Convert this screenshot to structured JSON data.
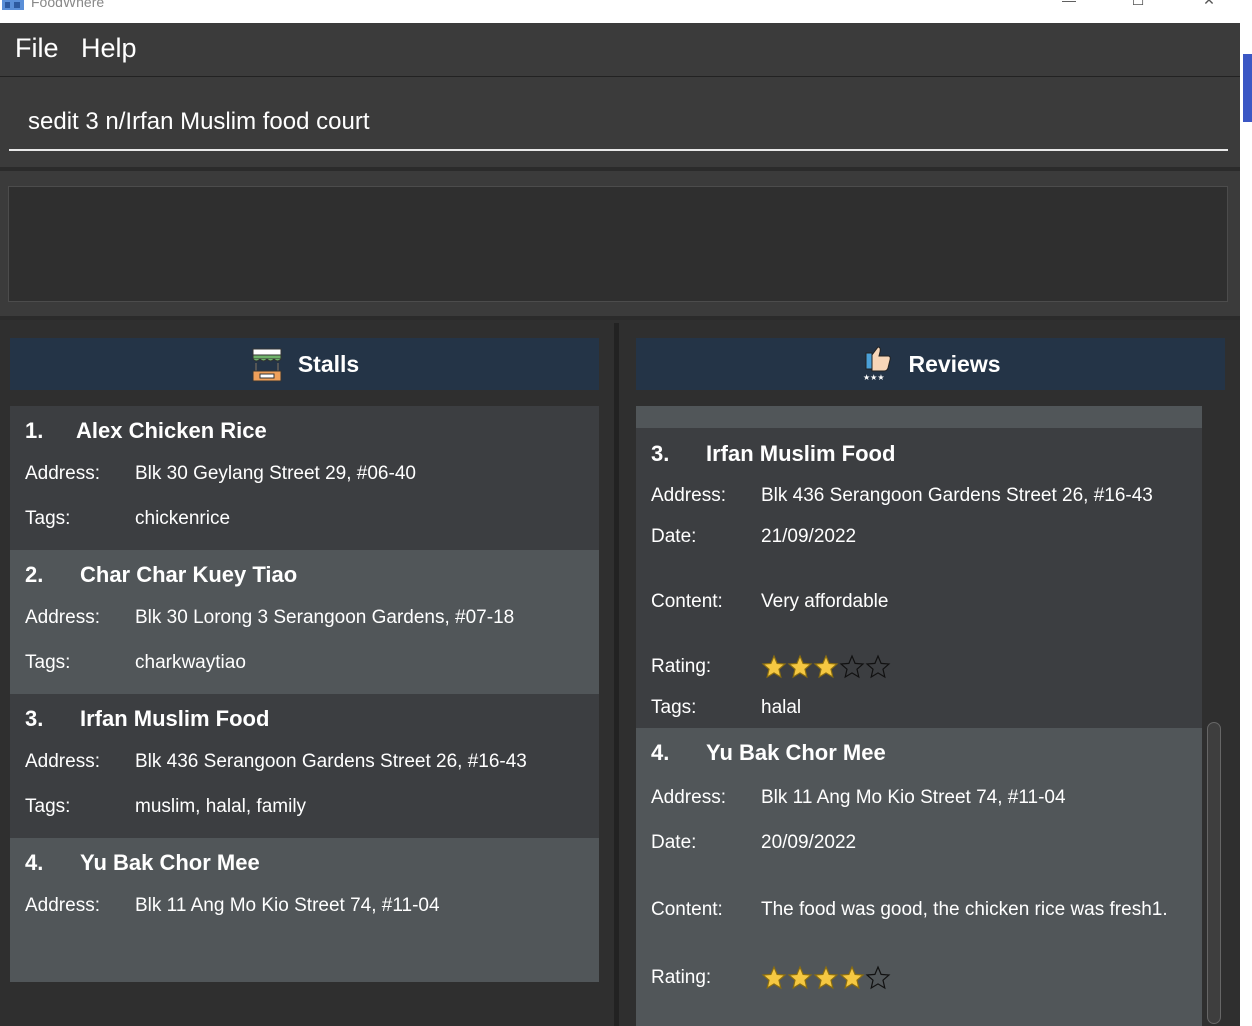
{
  "window": {
    "title": "FoodWhere",
    "minimize_icon": "minimize-icon",
    "maximize_icon": "maximize-icon",
    "close_icon": "close-icon"
  },
  "menu": {
    "file": "File",
    "help": "Help"
  },
  "command": {
    "value": "sedit 3 n/Irfan Muslim food court"
  },
  "result": {
    "text": ""
  },
  "stalls": {
    "header": "Stalls",
    "icon": "stall-icon",
    "items": [
      {
        "index": "1.",
        "name": "Alex Chicken Rice",
        "address_label": "Address:",
        "address": "Blk 30 Geylang Street 29, #06-40",
        "tags_label": "Tags:",
        "tags": "chickenrice"
      },
      {
        "index": "2.",
        "name": "Char Char Kuey Tiao",
        "address_label": "Address:",
        "address": "Blk 30 Lorong 3 Serangoon Gardens, #07-18",
        "tags_label": "Tags:",
        "tags": "charkwaytiao"
      },
      {
        "index": "3.",
        "name": "Irfan Muslim Food",
        "address_label": "Address:",
        "address": "Blk 436 Serangoon Gardens Street 26, #16-43",
        "tags_label": "Tags:",
        "tags": "muslim, halal, family"
      },
      {
        "index": "4.",
        "name": "Yu Bak Chor Mee",
        "address_label": "Address:",
        "address": "Blk 11 Ang Mo Kio Street 74, #11-04"
      }
    ]
  },
  "reviews": {
    "header": "Reviews",
    "icon": "thumbs-up-icon",
    "items": [
      {
        "index": "3.",
        "name": "Irfan Muslim Food",
        "address_label": "Address:",
        "address": "Blk 436 Serangoon Gardens Street 26, #16-43",
        "date_label": "Date:",
        "date": "21/09/2022",
        "content_label": "Content:",
        "content": "Very affordable",
        "rating_label": "Rating:",
        "rating": 3,
        "rating_max": 5,
        "tags_label": "Tags:",
        "tags": "halal"
      },
      {
        "index": "4.",
        "name": "Yu Bak Chor Mee",
        "address_label": "Address:",
        "address": "Blk 11 Ang Mo Kio Street 74, #11-04",
        "date_label": "Date:",
        "date": "20/09/2022",
        "content_label": "Content:",
        "content": "The food was good, the chicken rice was fresh1.",
        "rating_label": "Rating:",
        "rating": 4,
        "rating_max": 5
      }
    ]
  },
  "colors": {
    "header_bg": "#243447",
    "card_dark": "#3c3e41",
    "card_light": "#515659",
    "star_fill": "#f5c842"
  }
}
